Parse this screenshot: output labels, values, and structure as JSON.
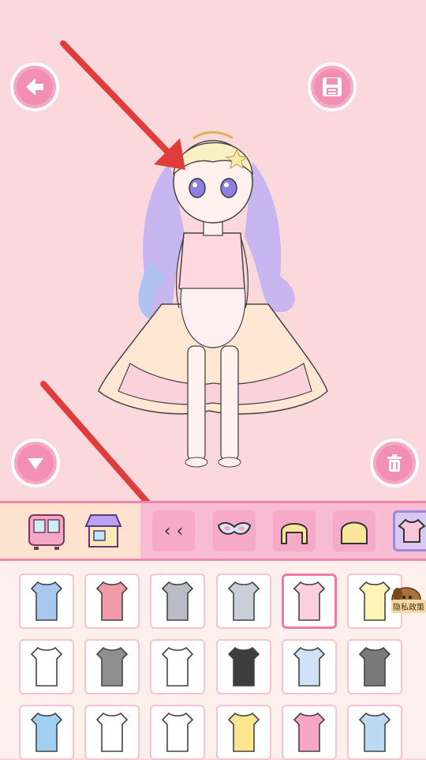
{
  "stage": {
    "background": "#fbd8dc",
    "buttons": [
      {
        "id": "back",
        "icon": "arrow-left-icon"
      },
      {
        "id": "save",
        "icon": "floppy-disk-icon"
      },
      {
        "id": "collapse",
        "icon": "triangle-down-icon"
      },
      {
        "id": "delete",
        "icon": "trash-icon"
      }
    ]
  },
  "character": {
    "description_icon": "doll-character"
  },
  "toolbar": {
    "left_icons": [
      "wardrobe-icon",
      "shop-icon"
    ],
    "categories": [
      "eyebrows-icon",
      "mask-icon",
      "hair-front-icon",
      "hair-back-icon",
      "top-shirt-icon"
    ],
    "active_category": "top-shirt-icon"
  },
  "privacy_badge": {
    "label": "隐私政策"
  },
  "items": {
    "rows": [
      [
        "denim-top",
        "watermelon-dress",
        "grey-vest",
        "grey-suit",
        "pink-frill-dress",
        "rainbow-top"
      ],
      [
        "white-crop-top",
        "striped-cami",
        "white-bandeau",
        "black-vest",
        "plaid-tie-top",
        "grey-corset"
      ],
      [
        "striped-tank",
        "strawberry-tee",
        "white-wrap",
        "polka-tee",
        "heart-cami",
        "plaid-shirt"
      ]
    ],
    "selected": "pink-frill-dress"
  }
}
